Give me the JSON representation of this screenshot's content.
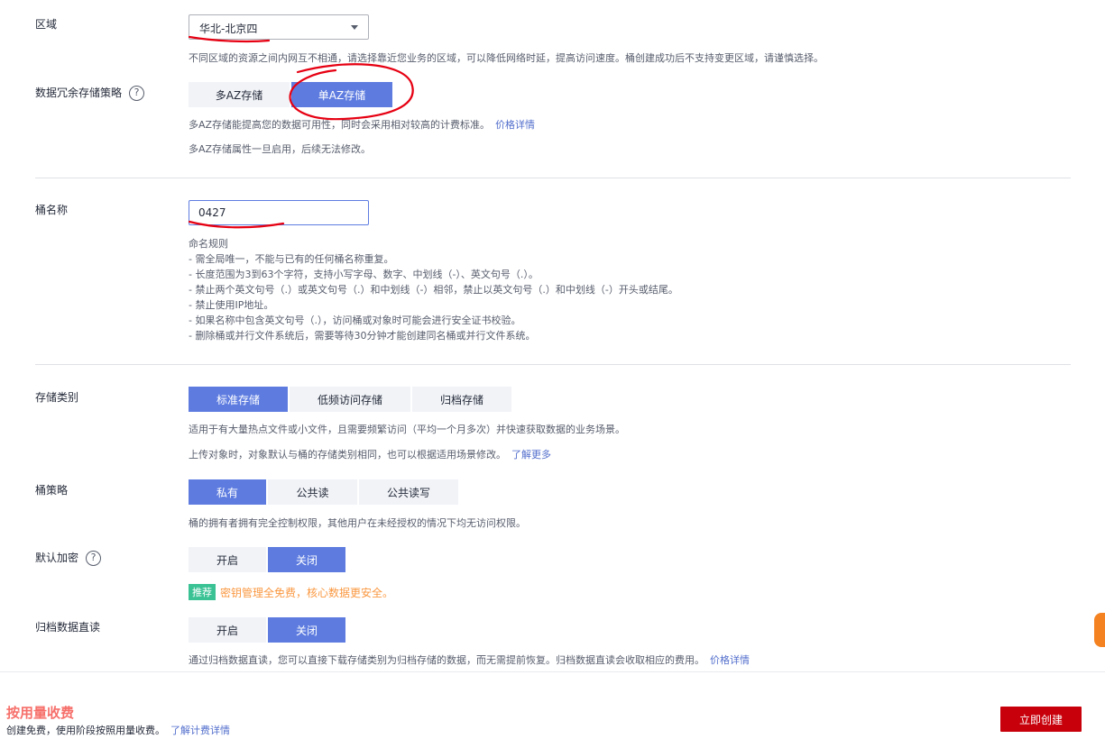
{
  "region": {
    "label": "区域",
    "selected": "华北-北京四",
    "hint": "不同区域的资源之间内网互不相通，请选择靠近您业务的区域，可以降低网络时延，提高访问速度。桶创建成功后不支持变更区域，请谨慎选择。"
  },
  "redundancy": {
    "label": "数据冗余存储策略",
    "options": [
      "多AZ存储",
      "单AZ存储"
    ],
    "selected": "单AZ存储",
    "hint1": "多AZ存储能提高您的数据可用性，同时会采用相对较高的计费标准。",
    "hint1_link": "价格详情",
    "hint2": "多AZ存储属性一旦启用，后续无法修改。"
  },
  "bucket_name": {
    "label": "桶名称",
    "value": "0427",
    "rules_title": "命名规则",
    "rules": [
      "- 需全局唯一，不能与已有的任何桶名称重复。",
      "- 长度范围为3到63个字符，支持小写字母、数字、中划线（-）、英文句号（.）。",
      "- 禁止两个英文句号（.）或英文句号（.）和中划线（-）相邻，禁止以英文句号（.）和中划线（-）开头或结尾。",
      "- 禁止使用IP地址。",
      "- 如果名称中包含英文句号（.），访问桶或对象时可能会进行安全证书校验。",
      "- 删除桶或并行文件系统后，需要等待30分钟才能创建同名桶或并行文件系统。"
    ]
  },
  "storage_class": {
    "label": "存储类别",
    "options": [
      "标准存储",
      "低频访问存储",
      "归档存储"
    ],
    "selected": "标准存储",
    "hint1": "适用于有大量热点文件或小文件，且需要频繁访问（平均一个月多次）并快速获取数据的业务场景。",
    "hint2": "上传对象时，对象默认与桶的存储类别相同，也可以根据适用场景修改。",
    "hint2_link": "了解更多"
  },
  "bucket_policy": {
    "label": "桶策略",
    "options": [
      "私有",
      "公共读",
      "公共读写"
    ],
    "selected": "私有",
    "hint": "桶的拥有者拥有完全控制权限，其他用户在未经授权的情况下均无访问权限。"
  },
  "encryption": {
    "label": "默认加密",
    "options": [
      "开启",
      "关闭"
    ],
    "selected": "关闭",
    "tag": "推荐",
    "promo": "密钥管理全免费，核心数据更安全。"
  },
  "archive_read": {
    "label": "归档数据直读",
    "options": [
      "开启",
      "关闭"
    ],
    "selected": "关闭",
    "hint": "通过归档数据直读，您可以直接下载存储类别为归档存储的数据，而无需提前恢复。归档数据直读会收取相应的费用。",
    "hint_link": "价格详情"
  },
  "footer": {
    "title": "按用量收费",
    "subtitle": "创建免费，使用阶段按照用量收费。",
    "subtitle_link": "了解计费详情",
    "create_label": "立即创建"
  },
  "colors": {
    "accent": "#5e7ce0",
    "primary_button": "#c7000b",
    "promo": "#fa9841",
    "tag": "#3ac295",
    "annotation": "#e60012"
  }
}
